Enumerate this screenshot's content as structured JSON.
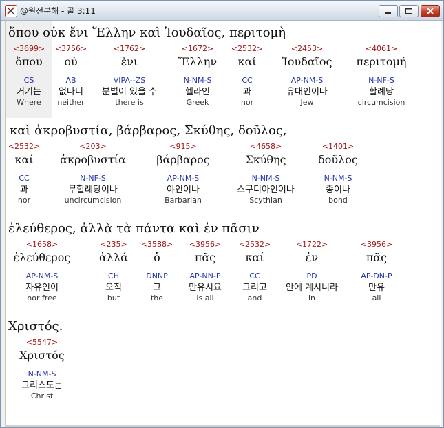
{
  "window": {
    "title": "@원전분해 - 골 3:11",
    "icon": "app-logo-icon",
    "controls": {
      "minimize": "minimize-icon",
      "maximize": "maximize-icon",
      "close": "close-icon"
    }
  },
  "colors": {
    "strong_number": "#a11818",
    "parsing": "#2233aa",
    "title_bar": "#dfe6ef",
    "close_button": "#c9412a"
  },
  "rows": [
    {
      "heading": "ὅπου   οὐκ   ἔνι   Ἕλλην   καὶ   Ἰουδαῖος,   περιτομὴ",
      "words": [
        {
          "strong": "<3699>",
          "lemma": "ὅπου",
          "parse": "CS",
          "korean": "거기는",
          "gloss": "Where"
        },
        {
          "strong": "<3756>",
          "lemma": "οὐ",
          "parse": "AB",
          "korean": "없나니",
          "gloss": "neither"
        },
        {
          "strong": "<1762>",
          "lemma": "ἔνι",
          "parse": "VIPA--ZS",
          "korean": "분별이 있을 수",
          "gloss": "there is"
        },
        {
          "strong": "<1672>",
          "lemma": "Ἕλλην",
          "parse": "N-NM-S",
          "korean": "헬라인",
          "gloss": "Greek"
        },
        {
          "strong": "<2532>",
          "lemma": "καί",
          "parse": "CC",
          "korean": "과",
          "gloss": "nor"
        },
        {
          "strong": "<2453>",
          "lemma": "Ἰουδαῖος",
          "parse": "AP-NM-S",
          "korean": "유대인이나",
          "gloss": "Jew"
        },
        {
          "strong": "<4061>",
          "lemma": "περιτομή",
          "parse": "N-NF-S",
          "korean": "할례당",
          "gloss": "circumcision"
        }
      ]
    },
    {
      "heading": "καὶ   ἀκροβυστία,   βάρβαρος,   Σκύθης,   δοῦλος,",
      "words": [
        {
          "strong": "<2532>",
          "lemma": "καί",
          "parse": "CC",
          "korean": "과",
          "gloss": "nor"
        },
        {
          "strong": "<203>",
          "lemma": "ἀκροβυστία",
          "parse": "N-NF-S",
          "korean": "무할례당이나",
          "gloss": "uncircumcision"
        },
        {
          "strong": "<915>",
          "lemma": "βάρβαρος",
          "parse": "AP-NM-S",
          "korean": "야인이나",
          "gloss": "Barbarian"
        },
        {
          "strong": "<4658>",
          "lemma": "Σκύθης",
          "parse": "N-NM-S",
          "korean": "스구디아인이나",
          "gloss": "Scythian"
        },
        {
          "strong": "<1401>",
          "lemma": "δοῦλος",
          "parse": "N-NM-S",
          "korean": "종이나",
          "gloss": "bond"
        }
      ]
    },
    {
      "heading": "ἐλεύθερος,   ἀλλὰ   τὰ   πάντα   καὶ   ἐν   πᾶσιν",
      "words": [
        {
          "strong": "<1658>",
          "lemma": "ἐλεύθερος",
          "parse": "AP-NM-S",
          "korean": "자유인이",
          "gloss": "nor free"
        },
        {
          "strong": "<235>",
          "lemma": "ἀλλά",
          "parse": "CH",
          "korean": "오직",
          "gloss": "but"
        },
        {
          "strong": "<3588>",
          "lemma": "ὁ",
          "parse": "DNNP",
          "korean": "그",
          "gloss": "the"
        },
        {
          "strong": "<3956>",
          "lemma": "πᾶς",
          "parse": "AP-NN-P",
          "korean": "만유시요",
          "gloss": "is all"
        },
        {
          "strong": "<2532>",
          "lemma": "καί",
          "parse": "CC",
          "korean": "그리고",
          "gloss": "and"
        },
        {
          "strong": "<1722>",
          "lemma": "ἐν",
          "parse": "PD",
          "korean": "안에 계시니라",
          "gloss": "in"
        },
        {
          "strong": "<3956>",
          "lemma": "πᾶς",
          "parse": "AP-DN-P",
          "korean": "만유",
          "gloss": "all"
        }
      ]
    },
    {
      "heading": "Χριστός.",
      "words": [
        {
          "strong": "<5547>",
          "lemma": "Χριστός",
          "parse": "N-NM-S",
          "korean": "그리스도는",
          "gloss": "Christ"
        }
      ]
    }
  ]
}
